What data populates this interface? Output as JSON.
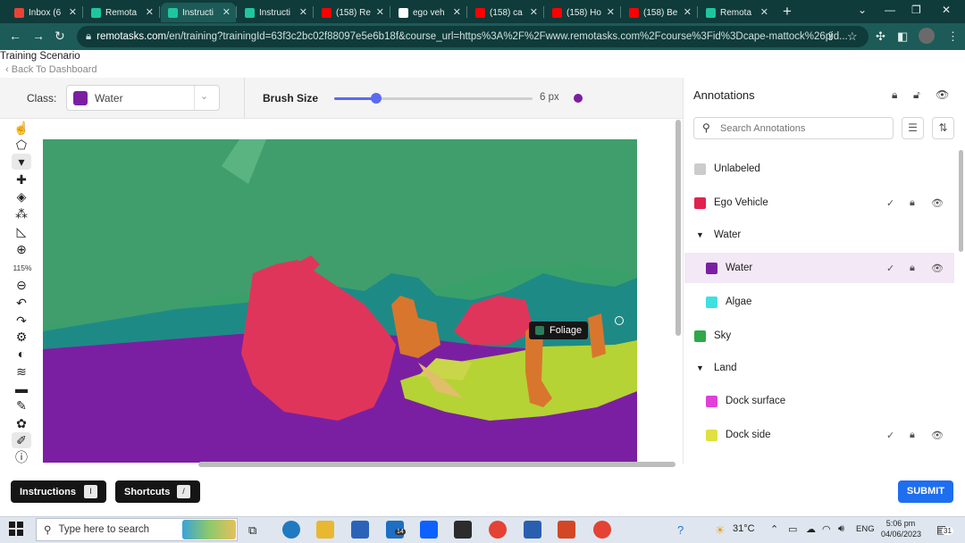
{
  "browser": {
    "tabs": [
      {
        "title": "Inbox (6",
        "icon": "gmail-icon",
        "color": "#ea4335"
      },
      {
        "title": "Remota",
        "icon": "remotasks-icon",
        "color": "#1ec6a0"
      },
      {
        "title": "Instructi",
        "icon": "remotasks-icon",
        "color": "#1ec6a0"
      },
      {
        "title": "Instructi",
        "icon": "remotasks-icon",
        "color": "#1ec6a0"
      },
      {
        "title": "(158) Re",
        "icon": "youtube-icon",
        "color": "#ff0000"
      },
      {
        "title": "ego veh",
        "icon": "google-icon",
        "color": "#ffffff"
      },
      {
        "title": "(158) ca",
        "icon": "youtube-icon",
        "color": "#ff0000"
      },
      {
        "title": "(158) Ho",
        "icon": "youtube-icon",
        "color": "#ff0000"
      },
      {
        "title": "(158) Be",
        "icon": "youtube-icon",
        "color": "#ff0000"
      },
      {
        "title": "Remota",
        "icon": "remotasks-icon",
        "color": "#1ec6a0"
      }
    ],
    "url_host": "remotasks.com",
    "url_rest": "/en/training?trainingId=63f3c2bc02f88097e5e6b18f&course_url=https%3A%2F%2Fwww.remotasks.com%2Fcourse%3Fid%3Dcape-mattock%26pid..."
  },
  "header": {
    "title": "Training Scenario",
    "back_label": "Back To Dashboard"
  },
  "toolbar": {
    "class_label": "Class:",
    "class_value": "Water",
    "class_color": "#7b1fa2",
    "brush_label": "Brush Size",
    "brush_value": "6 px",
    "brush_fraction": 0.21
  },
  "tools": {
    "zoom_level": "115%",
    "icons": [
      "hand-icon",
      "polygon-icon",
      "brush-icon",
      "puzzle-icon",
      "fill-bucket-icon",
      "magic-wand-icon",
      "ruler-icon",
      "zoom-in-icon",
      "zoom-out-icon",
      "undo-icon",
      "redo-icon",
      "settings-icon",
      "contrast-icon",
      "layers-icon",
      "pencil-tool-icon",
      "eyedropper-icon",
      "palette-icon",
      "eraser-icon",
      "info-icon"
    ]
  },
  "canvas": {
    "tooltip_label": "Foliage",
    "tooltip_color": "#2e7d5a"
  },
  "annotations": {
    "title": "Annotations",
    "search_placeholder": "Search Annotations",
    "items": [
      {
        "label": "Unlabeled",
        "color": "#cccccc",
        "type": "class"
      },
      {
        "label": "Ego Vehicle",
        "color": "#e0234e",
        "type": "class",
        "icons": true
      },
      {
        "label": "Water",
        "type": "group"
      },
      {
        "label": "Water",
        "color": "#7b1fa2",
        "type": "child",
        "icons": true,
        "selected": true
      },
      {
        "label": "Algae",
        "color": "#3ee0e0",
        "type": "child"
      },
      {
        "label": "Sky",
        "color": "#2ea84a",
        "type": "class"
      },
      {
        "label": "Land",
        "type": "group"
      },
      {
        "label": "Dock surface",
        "color": "#e040d8",
        "type": "child"
      },
      {
        "label": "Dock side",
        "color": "#e0e040",
        "type": "child",
        "icons": true
      }
    ]
  },
  "footer": {
    "instructions_label": "Instructions",
    "instructions_key": "I",
    "shortcuts_label": "Shortcuts",
    "shortcuts_key": "/",
    "submit_label": "SUBMIT"
  },
  "taskbar": {
    "search_placeholder": "Type here to search",
    "mail_badge": "14",
    "weather": "31°C",
    "language": "ENG",
    "time": "5:06 pm",
    "date": "04/06/2023",
    "notif_count": "31"
  }
}
